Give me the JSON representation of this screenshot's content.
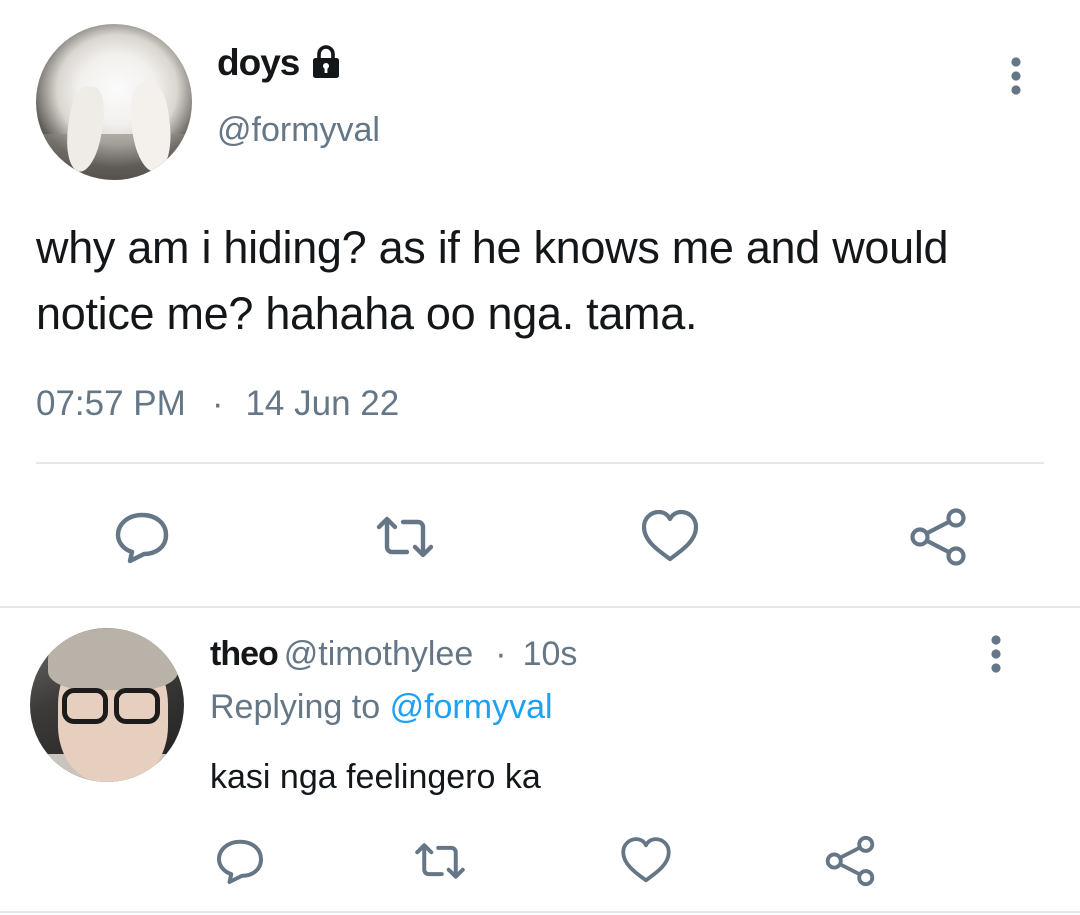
{
  "tweet": {
    "display_name": "doys",
    "handle": "@formyval",
    "text": "why am i hiding? as if he knows me and would notice me? hahaha oo nga. tama.",
    "time": "07:57 PM",
    "separator": "·",
    "date": "14 Jun 22",
    "protected": true
  },
  "reply": {
    "display_name": "theo",
    "handle": "@timothylee",
    "separator": "·",
    "age": "10s",
    "replying_label": "Replying to",
    "replying_to": "@formyval",
    "text": "kasi nga feelingero ka"
  },
  "icons": {
    "lock": "lock-icon",
    "more": "vertical-ellipsis-icon",
    "reply": "comment-bubble-icon",
    "retweet": "retweet-icon",
    "like": "heart-icon",
    "share": "share-icon"
  },
  "colors": {
    "text": "#14171a",
    "secondary": "#657786",
    "link": "#1da1f2",
    "divider": "#e1e8ed"
  }
}
